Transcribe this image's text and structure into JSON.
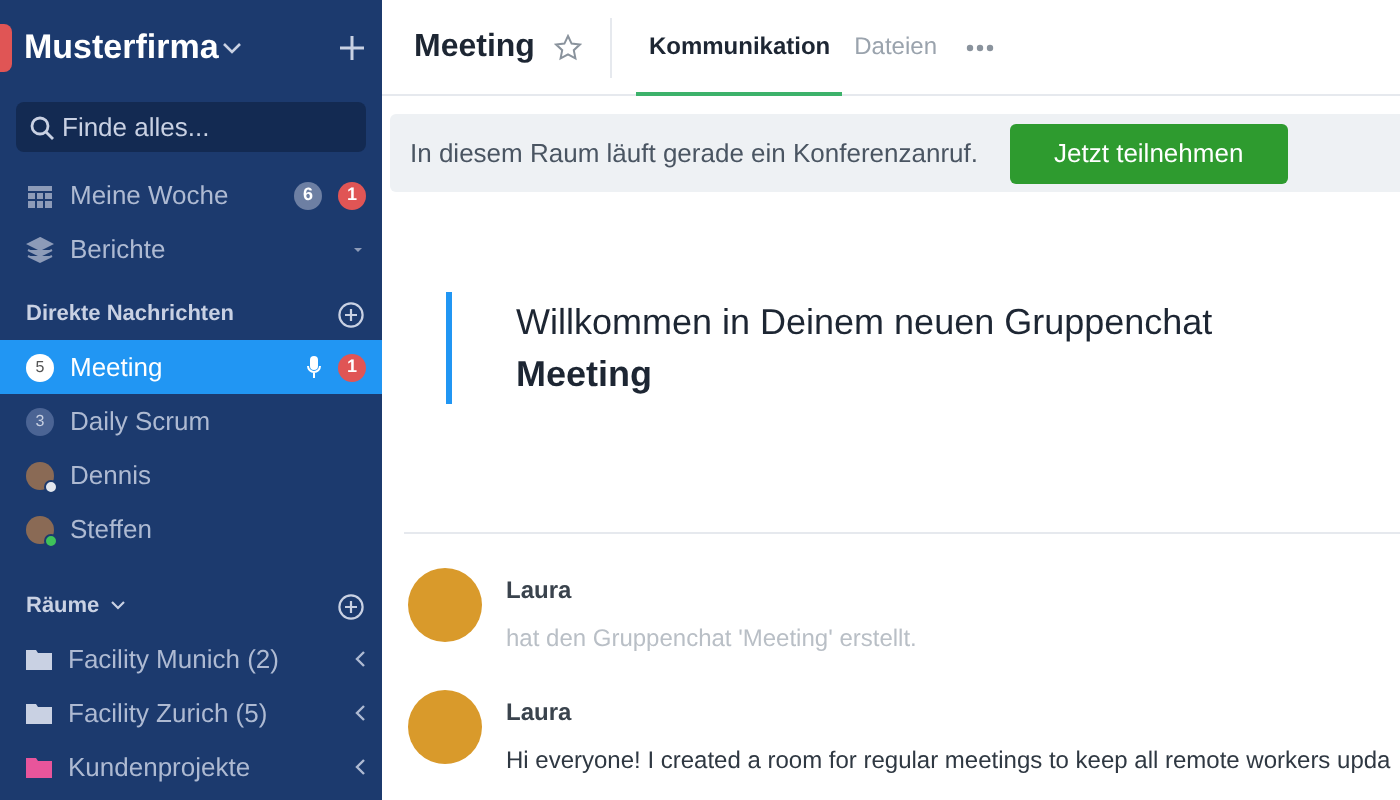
{
  "workspace": {
    "name": "Musterfirma"
  },
  "search": {
    "placeholder": "Finde alles..."
  },
  "nav": [
    {
      "kind": "calendar",
      "label": "Meine Woche",
      "count": "6",
      "unread": "1"
    },
    {
      "kind": "layers",
      "label": "Berichte",
      "expandable": true
    }
  ],
  "direct_messages": {
    "title": "Direkte Nachrichten",
    "items": [
      {
        "kind": "group",
        "badge": "5",
        "label": "Meeting",
        "selected": true,
        "call_active": true,
        "unread": "1"
      },
      {
        "kind": "group",
        "badge": "3",
        "label": "Daily Scrum",
        "selected": false,
        "call_active": false
      },
      {
        "kind": "user",
        "label": "Dennis",
        "selected": false,
        "online": false
      },
      {
        "kind": "user",
        "label": "Steffen",
        "selected": false,
        "online": true
      }
    ]
  },
  "rooms": {
    "title": "Räume",
    "items": [
      {
        "label": "Facility Munich (2)",
        "color": "#c9d1e3"
      },
      {
        "label": "Facility Zurich (5)",
        "color": "#c9d1e3"
      },
      {
        "label": "Kundenprojekte",
        "color": "#e8559b"
      }
    ]
  },
  "header": {
    "title": "Meeting",
    "starred": false,
    "tabs": [
      {
        "label": "Kommunikation",
        "selected": true
      },
      {
        "label": "Dateien",
        "selected": false
      }
    ]
  },
  "banner": {
    "text": "In diesem Raum läuft gerade ein Konferenzanruf.",
    "button": "Jetzt teilnehmen"
  },
  "welcome": {
    "text": "Willkommen in Deinem neuen Gruppenchat **Meeting**"
  },
  "messages": [
    {
      "kind": "system",
      "author": "Laura",
      "text": "hat den Gruppenchat 'Meeting' erstellt."
    },
    {
      "kind": "message",
      "author": "Laura",
      "text": "Hi everyone! I created a room for regular meetings to keep all remote workers upda"
    }
  ]
}
